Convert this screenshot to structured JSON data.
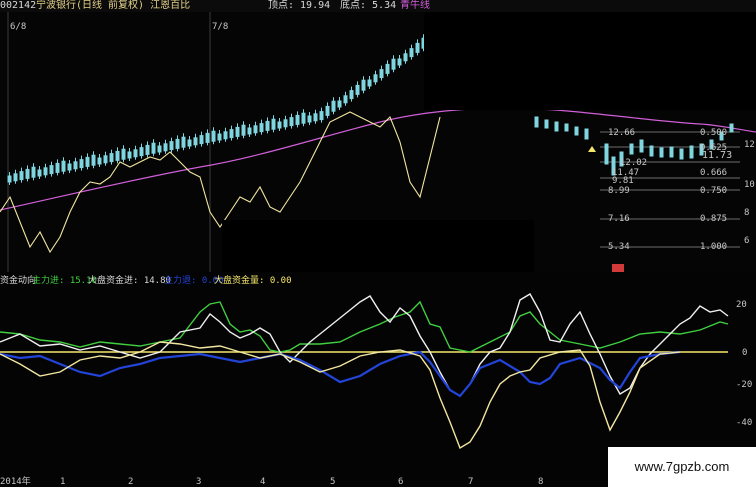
{
  "header": {
    "code": "002142",
    "title": "宁波银行(日线 前复权) 江恩百比",
    "high_label": "顶点: 19.94",
    "low_label": "底点: 5.34",
    "indicator": "青牛线"
  },
  "upper": {
    "tick_marks": [
      "6/8",
      "7/8"
    ],
    "gann_levels": [
      {
        "price": "12.66",
        "frac": "0.500"
      },
      {
        "price": "12.02",
        "frac": "0.625"
      },
      {
        "price": "11.47",
        "frac": "0.666"
      },
      {
        "price": "9.81",
        "frac": ""
      },
      {
        "price": "8.99",
        "frac": "0.750"
      },
      {
        "price": "7.16",
        "frac": "0.875"
      },
      {
        "price": "5.34",
        "frac": "1.000"
      }
    ],
    "last_price": "11.73",
    "right_axis": [
      "12",
      "10",
      "8",
      "6"
    ]
  },
  "lower": {
    "title": "资金动向",
    "main_in_label": "主力进: 15.10",
    "market_in_label": "大盘资金进: 14.80",
    "main_out_label": "主力退: 0.00",
    "market_amt_label": "大盘资金量: 0.00",
    "right_axis": [
      "20",
      "0",
      "-20",
      "-40"
    ]
  },
  "xaxis": [
    "2014年",
    "1",
    "2",
    "3",
    "4",
    "5",
    "6",
    "7",
    "8"
  ],
  "watermark": "www.7gpzb.com",
  "colors": {
    "green": "#3fcf3f",
    "white": "#f0f0f0",
    "blue": "#2344d8",
    "yellow": "#f5e76b",
    "magenta": "#d05fd8",
    "candle": "#7fd6e0",
    "yellow_gann": "#f2e6a0"
  }
}
